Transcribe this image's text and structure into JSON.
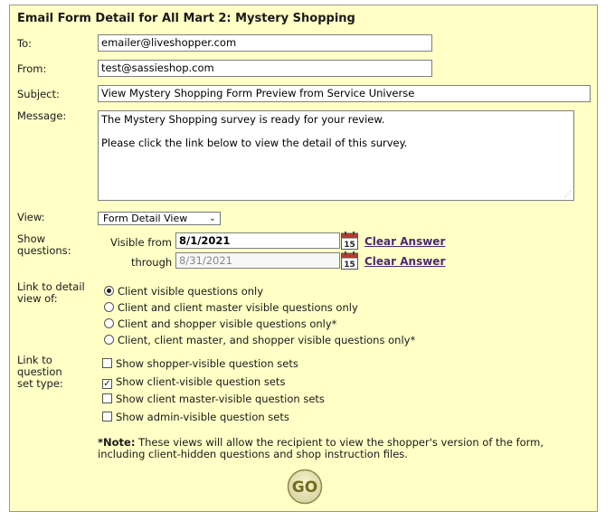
{
  "title": "Email Form Detail for All Mart 2: Mystery Shopping",
  "fields": {
    "to_label": "To:",
    "to_value": "emailer@liveshopper.com",
    "from_label": "From:",
    "from_value": "test@sassieshop.com",
    "subject_label": "Subject:",
    "subject_value": "View Mystery Shopping Form Preview from Service Universe",
    "message_label": "Message:",
    "message_line1": "The Mystery Shopping survey is ready for your review.",
    "message_line2": "Please click the link below to view the detail of this survey."
  },
  "view": {
    "label": "View:",
    "selected": "Form Detail View"
  },
  "show_questions": {
    "label_line1": "Show",
    "label_line2": "questions:",
    "visible_from_label": "Visible from",
    "visible_from_value": "8/1/2021",
    "through_label": "through",
    "through_value": "8/31/2021",
    "clear_label": "Clear Answer",
    "calendar_day": "15"
  },
  "link_detail": {
    "label_line1": "Link to detail",
    "label_line2": "view of:",
    "options": [
      "Client visible questions only",
      "Client and client master visible questions only",
      "Client and shopper visible questions only*",
      "Client, client master, and shopper visible questions only*"
    ],
    "selected_index": 0
  },
  "link_question_sets": {
    "label_line1": "Link to",
    "label_line2": "question",
    "label_line3": "set type:",
    "options": [
      "Show shopper-visible question sets",
      "Show client-visible question sets",
      "Show client master-visible question sets",
      "Show admin-visible question sets"
    ],
    "checked": [
      false,
      true,
      false,
      false
    ]
  },
  "note": {
    "prefix": "*Note:",
    "text": " These views will allow the recipient to view the shopper's version of the form, including client-hidden questions and shop instruction files."
  },
  "go_button": "GO",
  "colors": {
    "panel_bg": "#ffffc6",
    "link": "#4a2a7a",
    "go_button": "#7a7a20"
  }
}
